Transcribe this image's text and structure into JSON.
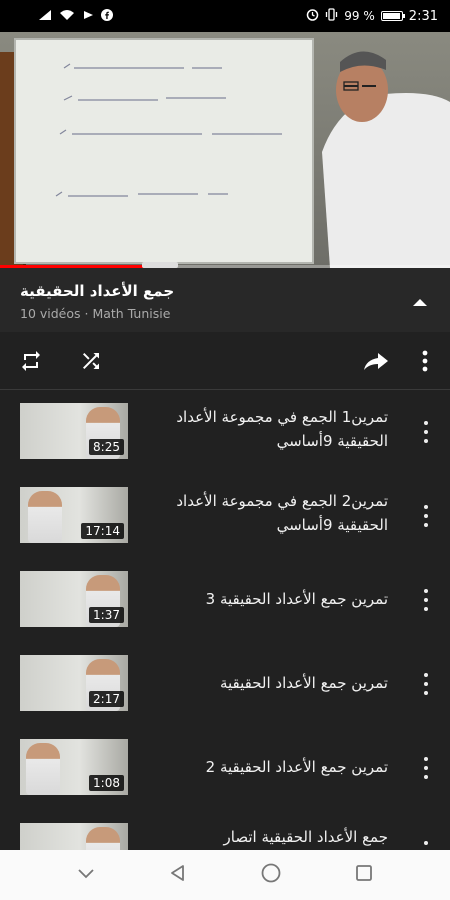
{
  "status_bar": {
    "battery_percent": "99 %",
    "time": "2:31",
    "icons": [
      "signal-icon",
      "wifi-icon",
      "cast-icon",
      "facebook-icon",
      "alarm-icon",
      "vibrate-icon",
      "battery-icon"
    ]
  },
  "video": {
    "progress": 0.33,
    "accent_color": "#ff0000"
  },
  "playlist": {
    "title": "جمع الأعداد الحقيقية",
    "subtitle": "10 vidéos · Math Tunisie"
  },
  "actions": {
    "icons": [
      "loop-icon",
      "shuffle-icon",
      "share-icon",
      "more-vert-icon"
    ]
  },
  "items": [
    {
      "title": "تمرين1 الجمع في مجموعة الأعداد الحقيقية 9أساسي",
      "duration": "8:25"
    },
    {
      "title": "تمرين2 الجمع في مجموعة الأعداد الحقيقية 9أساسي",
      "duration": "17:14"
    },
    {
      "title": "تمرين جمع الأعداد الحقيقية 3",
      "duration": "1:37"
    },
    {
      "title": "تمرين جمع الأعداد الحقيقية",
      "duration": "2:17"
    },
    {
      "title": "تمرين جمع الأعداد الحقيقية 2",
      "duration": "1:08"
    },
    {
      "title": "جمع الأعداد الحقيقية  اتصار",
      "duration": ""
    }
  ],
  "navbar": {
    "icons": [
      "chevron-down-icon",
      "back-icon",
      "home-icon",
      "recents-icon"
    ]
  }
}
